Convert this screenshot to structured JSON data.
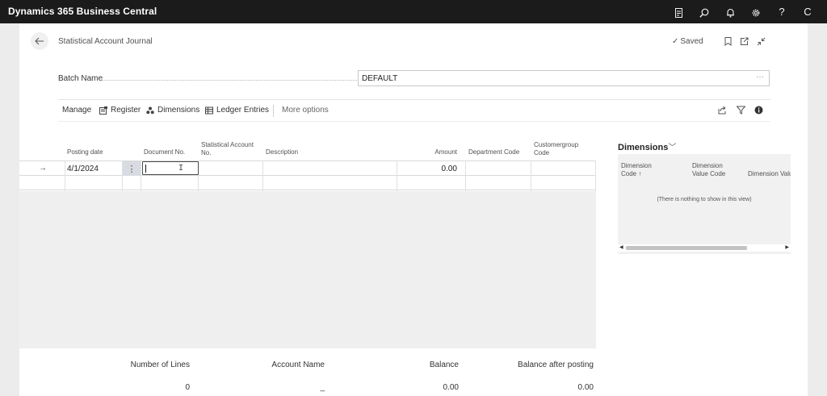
{
  "app": {
    "title": "Dynamics 365 Business Central",
    "top_icons": [
      "document-icon",
      "search-icon",
      "bell-icon",
      "gear-icon",
      "help-icon",
      "avatar-c"
    ],
    "help_label": "?",
    "avatar_initial": "C"
  },
  "page": {
    "title": "Statistical Account Journal",
    "saved_label": "Saved"
  },
  "batch": {
    "label": "Batch Name",
    "value": "DEFAULT",
    "more": "···"
  },
  "actions": {
    "manage": "Manage",
    "register": "Register",
    "dimensions": "Dimensions",
    "ledger_entries": "Ledger Entries",
    "more_options": "More options"
  },
  "grid": {
    "columns": {
      "posting_date": "Posting date",
      "document_no": "Document No.",
      "stat_account_no_1": "Statistical Account",
      "stat_account_no_2": "No.",
      "description": "Description",
      "amount": "Amount",
      "department_code": "Department Code",
      "customergroup_code_1": "Customergroup",
      "customergroup_code_2": "Code"
    },
    "rows": [
      {
        "posting_date": "4/1/2024",
        "document_no": "",
        "stat_account_no": "",
        "description": "",
        "amount": "0.00",
        "department_code": "",
        "customergroup_code": ""
      }
    ],
    "row_arrow": "→",
    "row_menu": "⋮"
  },
  "dimensions_pane": {
    "title": "Dimensions",
    "col1_line1": "Dimension",
    "col1_line2": "Code ↑",
    "col2_line1": "Dimension",
    "col2_line2": "Value Code",
    "col3": "Dimension Valu",
    "empty_text": "(There is nothing to show in this view)"
  },
  "totals": {
    "number_of_lines_label": "Number of Lines",
    "number_of_lines_value": "0",
    "account_name_label": "Account Name",
    "account_name_value": "_",
    "balance_label": "Balance",
    "balance_value": "0.00",
    "balance_after_label": "Balance after posting",
    "balance_after_value": "0.00"
  }
}
